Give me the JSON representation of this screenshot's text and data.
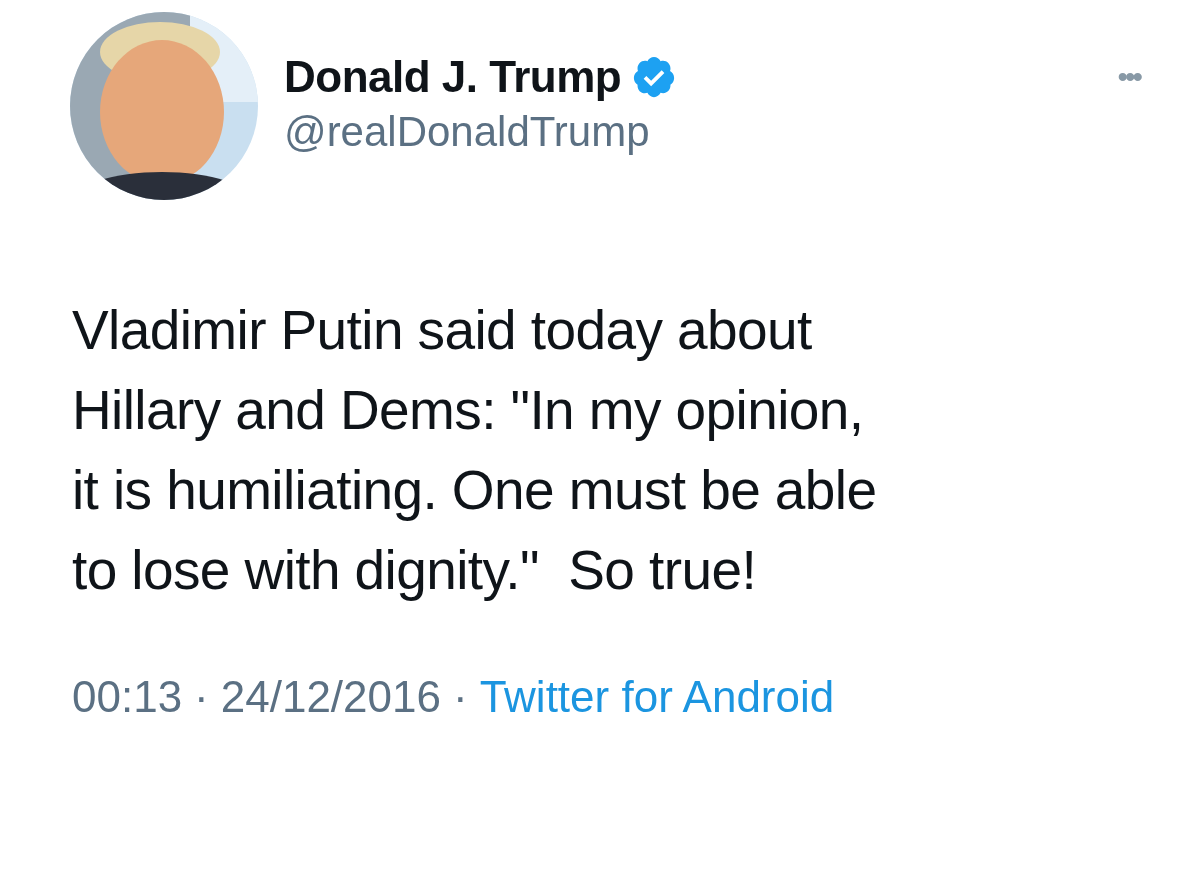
{
  "author": {
    "name": "Donald J. Trump",
    "verified": true,
    "handle": "@realDonaldTrump"
  },
  "menu": {
    "label": "•••"
  },
  "tweet": {
    "lines": [
      "Vladimir Putin said today about",
      "Hillary and Dems: \"In my opinion,",
      "it is humiliating. One must be able",
      "to lose with dignity.\"  So true!"
    ]
  },
  "footer": {
    "time": "00:13",
    "separator": "·",
    "date": "24/12/2016",
    "source": "Twitter for Android"
  }
}
